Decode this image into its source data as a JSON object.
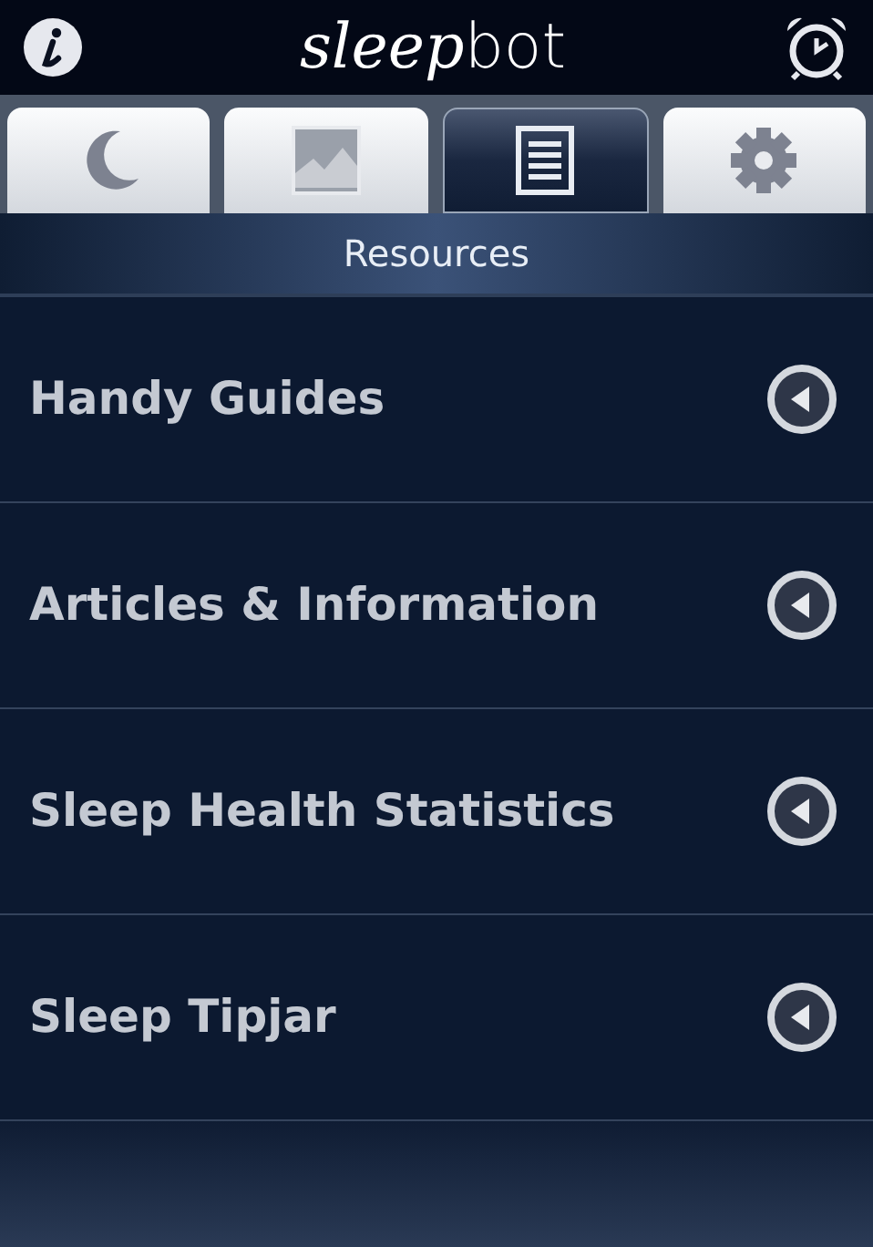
{
  "app_bar": {
    "logo": [
      "sleep",
      "bot"
    ]
  },
  "tabs": [
    {
      "kind": "moon",
      "selected": false
    },
    {
      "kind": "chart",
      "selected": false
    },
    {
      "kind": "list",
      "selected": true
    },
    {
      "kind": "gear",
      "selected": false
    }
  ],
  "header": {
    "title": "Resources"
  },
  "items": [
    {
      "label": "Handy Guides"
    },
    {
      "label": "Articles & Information"
    },
    {
      "label": "Sleep Health Statistics"
    },
    {
      "label": "Sleep Tipjar"
    }
  ]
}
